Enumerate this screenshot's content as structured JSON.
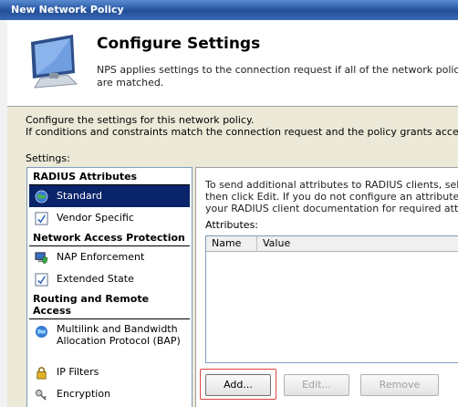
{
  "window": {
    "title": "New Network Policy"
  },
  "header": {
    "title": "Configure Settings",
    "description_line1": "NPS applies settings to the connection request if all of the network policy cond",
    "description_line2": "are matched."
  },
  "intro": {
    "line1": "Configure the settings for this network policy.",
    "line2": "If conditions and constraints match the connection request and the policy grants access, settings ar"
  },
  "settings": {
    "label": "Settings:",
    "categories": [
      {
        "title": "RADIUS Attributes"
      },
      {
        "title": "Network Access Protection"
      },
      {
        "title": "Routing and Remote Access"
      }
    ],
    "items": [
      {
        "label": "Standard",
        "icon": "globe-icon",
        "selected": true
      },
      {
        "label": "Vendor Specific",
        "icon": "checklist-icon"
      },
      {
        "label": "NAP Enforcement",
        "icon": "computer-shield-icon"
      },
      {
        "label": "Extended State",
        "icon": "checklist-icon"
      },
      {
        "label": "Multilink and Bandwidth Allocation Protocol (BAP)",
        "icon": "globe-icon"
      },
      {
        "label": "IP Filters",
        "icon": "lock-icon"
      },
      {
        "label": "Encryption",
        "icon": "key-icon"
      }
    ]
  },
  "detail": {
    "desc_line1": "To send additional attributes to RADIUS clients, select a F",
    "desc_line2": "then click Edit. If you do not configure an attribute, it is not",
    "desc_line3": "your RADIUS client documentation for required attributes.",
    "attributes_label": "Attributes:",
    "columns": [
      "Name",
      "Value"
    ],
    "buttons": {
      "add": "Add...",
      "edit": "Edit...",
      "remove": "Remove"
    }
  },
  "colors": {
    "selection": "#0a246a",
    "titlebar": "#2a5aa6"
  }
}
